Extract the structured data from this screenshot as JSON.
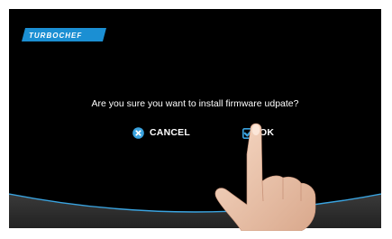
{
  "branding": {
    "logo_text": "TURBOCHEF",
    "logo_bg_color": "#1b8fd3"
  },
  "dialog": {
    "message": "Are you sure you want to install firmware udpate?",
    "cancel_label": "CANCEL",
    "ok_label": "OK"
  },
  "icons": {
    "cancel": "close-circle-icon",
    "ok": "checkbox-check-icon",
    "logo_o": "power-ring-icon"
  },
  "colors": {
    "accent": "#3aa3df",
    "screen_background": "#000000",
    "footer_panel": "#2b2b2b",
    "text": "#ffffff"
  }
}
